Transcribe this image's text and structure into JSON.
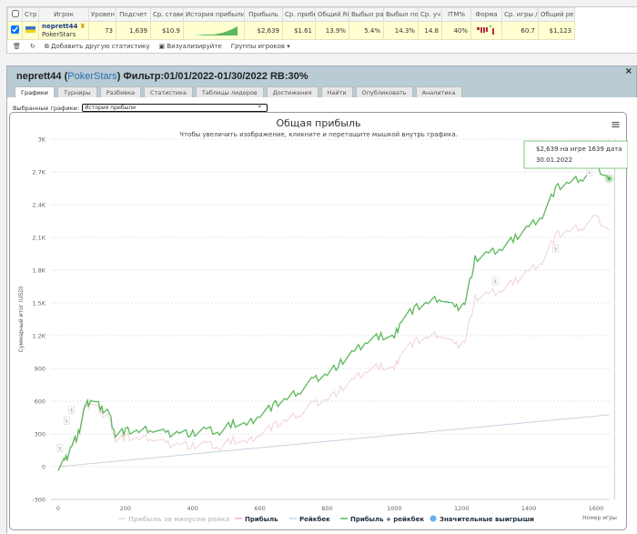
{
  "table": {
    "headers": [
      "Стр",
      "Игрок",
      "Уровен",
      "Подсчет",
      "Ср. ставк",
      "История прибыли",
      "Прибыль",
      "Ср. прибыл",
      "Общий ROI",
      "Выбыл рано",
      "Выбыл поздн",
      "Ср. уч",
      "ITM%",
      "Форма",
      "Ср. игры / ,",
      "Общий рей"
    ],
    "row": {
      "player": "neprett44",
      "site": "PokerStars",
      "level": "73",
      "count": "1,639",
      "avg_stake": "$10.9",
      "profit": "$2,639",
      "avg_profit": "$1.61",
      "roi": "13.9%",
      "early": "5.4%",
      "late": "14.3%",
      "avg_entrants": "14.8",
      "itm": "40%",
      "avg_games": "60.7",
      "rake": "$1,123"
    }
  },
  "toolbar": {
    "add_stat": "Добавить другую статистику",
    "visualize": "Визуализируйте",
    "groups": "Группы игроков ▾"
  },
  "panel": {
    "player": "neprett44",
    "site": "PokerStars",
    "filter": "Фильтр:01/01/2022-01/30/2022 RB:30%",
    "close": "×"
  },
  "tabs": [
    "Графики",
    "Турниры",
    "Разбивка",
    "Статистика",
    "Таблицы лидеров",
    "Достижения",
    "Найти",
    "Опубликовать",
    "Аналитика"
  ],
  "select": {
    "label": "Выбранные графики:",
    "value": "История прибыли"
  },
  "tooltip": {
    "line1": "$2,639 на игре 1639 дата",
    "line2": "30.01.2022"
  },
  "colors": {
    "green": "#5cb85c",
    "profit": "#e8b4b8",
    "rake": "#c8d3e0",
    "net": "#dddddd",
    "accent": "#2a6ab2"
  },
  "chart_data": {
    "type": "line",
    "title": "Общая прибыль",
    "subtitle": "Чтобы увеличить изображение, кликните и перетащите мышкой внутрь графика.",
    "xlabel": "Номер игры",
    "ylabel": "Суммарный итог (USD)",
    "xlim": [
      0,
      1650
    ],
    "ylim": [
      -300,
      3000
    ],
    "xticks": [
      0,
      200,
      400,
      600,
      800,
      1000,
      1200,
      1400,
      1600
    ],
    "yticks": [
      {
        "v": -300,
        "l": "-300"
      },
      {
        "v": 0,
        "l": "0"
      },
      {
        "v": 300,
        "l": "300"
      },
      {
        "v": 600,
        "l": "600"
      },
      {
        "v": 900,
        "l": "900"
      },
      {
        "v": 1200,
        "l": "1.2K"
      },
      {
        "v": 1500,
        "l": "1.5K"
      },
      {
        "v": 1800,
        "l": "1.8K"
      },
      {
        "v": 2100,
        "l": "2.1K"
      },
      {
        "v": 2400,
        "l": "2.4K"
      },
      {
        "v": 2700,
        "l": "2.7K"
      },
      {
        "v": 3000,
        "l": "3K"
      }
    ],
    "x": [
      0,
      20,
      40,
      60,
      80,
      100,
      130,
      150,
      170,
      200,
      240,
      280,
      320,
      360,
      400,
      440,
      480,
      520,
      560,
      600,
      640,
      680,
      720,
      760,
      800,
      840,
      880,
      920,
      960,
      1000,
      1020,
      1060,
      1100,
      1140,
      1180,
      1210,
      1240,
      1280,
      1320,
      1360,
      1400,
      1440,
      1480,
      1520,
      1560,
      1600,
      1639
    ],
    "series": [
      {
        "name": "Прибыль + рейкбек",
        "values": [
          0,
          50,
          200,
          300,
          550,
          620,
          530,
          500,
          300,
          330,
          320,
          350,
          300,
          320,
          300,
          340,
          310,
          400,
          380,
          480,
          560,
          620,
          700,
          800,
          850,
          950,
          1050,
          1150,
          1200,
          1180,
          1350,
          1450,
          1500,
          1550,
          1450,
          1500,
          1900,
          1950,
          2000,
          2100,
          2200,
          2300,
          2550,
          2600,
          2650,
          2750,
          2639
        ]
      },
      {
        "name": "Прибыль",
        "values": [
          0,
          44,
          188,
          283,
          527,
          591,
          492,
          456,
          251,
          272,
          250,
          269,
          207,
          216,
          184,
          212,
          171,
          249,
          218,
          306,
          374,
          423,
          491,
          580,
          618,
          706,
          795,
          883,
          922,
          890,
          1054,
          1143,
          1181,
          1219,
          1108,
          1149,
          1540,
          1579,
          1617,
          1706,
          1794,
          1882,
          2121,
          2159,
          2198,
          2286,
          2164
        ]
      },
      {
        "name": "Рейкбек",
        "x": [
          0,
          1639
        ],
        "values": [
          0,
          475
        ]
      },
      {
        "name": "Прибыль за минусом рейка"
      }
    ],
    "big_wins": [
      [
        5,
        170
      ],
      [
        25,
        420
      ],
      [
        40,
        520
      ],
      [
        1480,
        2000
      ],
      [
        1300,
        1700
      ],
      [
        1580,
        2700
      ]
    ],
    "legend": [
      "Прибыль за минусом рейка",
      "Прибыль",
      "Рейкбек",
      "Прибыль + рейкбек",
      "Значительные выигрыши"
    ],
    "legend_position": "bottom",
    "grid": true
  }
}
